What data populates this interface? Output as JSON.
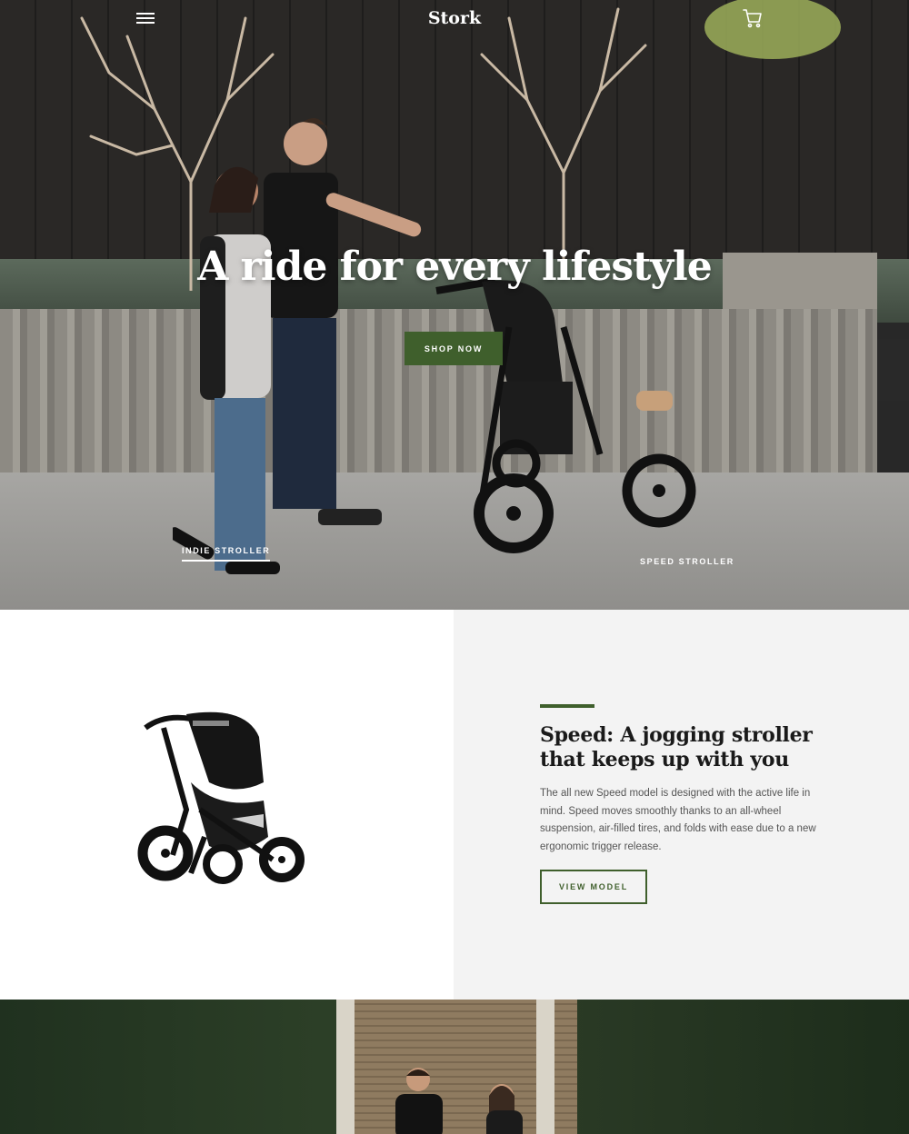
{
  "header": {
    "logo": "Stork",
    "menu_icon": "hamburger-menu-icon",
    "cart_icon": "cart-icon"
  },
  "hero": {
    "title": "A ride for every lifestyle",
    "cta_label": "SHOP NOW",
    "slides": [
      {
        "label": "INDIE STROLLER",
        "active": true
      },
      {
        "label": "SPEED STROLLER",
        "active": false
      }
    ]
  },
  "feature": {
    "title_line1": "Speed: A jogging stroller",
    "title_line2": "that keeps up with you",
    "description": "The all new Speed model is designed with the active life in mind. Speed moves smoothly thanks to an all-wheel suspension, air-filled tires, and folds with ease due to a new ergonomic trigger release.",
    "cta_label": "VIEW MODEL"
  },
  "colors": {
    "accent": "#3f5f2c",
    "panel_bg": "#f3f3f3"
  }
}
